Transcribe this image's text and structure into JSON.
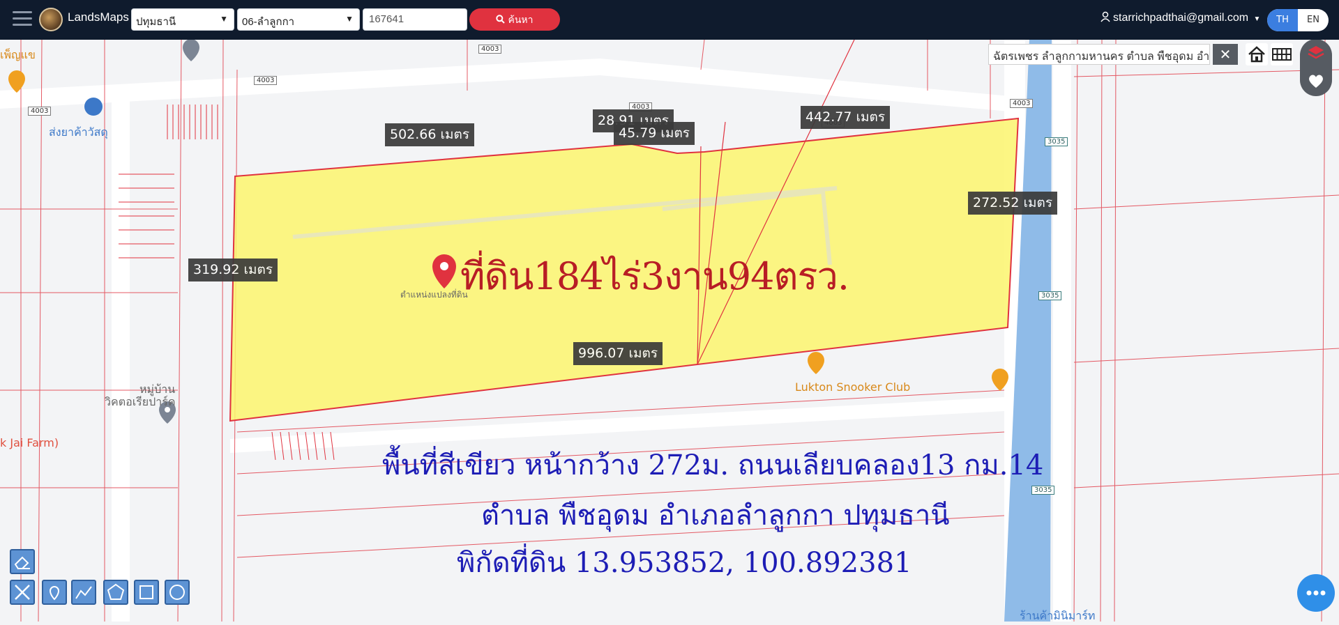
{
  "topbar": {
    "brand": "LandsMaps",
    "province": "ปทุมธานี",
    "district": "06-ลำลูกกา",
    "parcel_no": "167641",
    "search_label": "ค้นหา",
    "user_email": "starrichpadthai@gmail.com",
    "lang_th": "TH",
    "lang_en": "EN"
  },
  "map": {
    "address": "ฉัตรเพชร ลำลูกกามหานคร ตำบล พืชอุดม อำเภ",
    "close_label": "✕",
    "title": "ที่ดิน184ไร่3งาน94ตรว.",
    "pin_label": "ตำแหน่งแปลงที่ดิน",
    "distances": [
      {
        "id": "d1",
        "text": "502.66 เมตร"
      },
      {
        "id": "d2",
        "text": "28.91 เมตร"
      },
      {
        "id": "d3",
        "text": "45.79 เมตร"
      },
      {
        "id": "d4",
        "text": "442.77 เมตร"
      },
      {
        "id": "d5",
        "text": "272.52 เมตร"
      },
      {
        "id": "d6",
        "text": "319.92 เมตร"
      },
      {
        "id": "d7",
        "text": "996.07 เมตร"
      }
    ],
    "roads": {
      "r4003a": "4003",
      "r4003b": "4003",
      "r4003c": "4003",
      "r4003d": "4003",
      "r4003e": "4003",
      "r4003f": "4003",
      "r3035a": "3035",
      "r3035b": "3035",
      "r3035c": "3035"
    },
    "pois": {
      "hardware": "ส่งยาค้าวัสดุ",
      "village_line1": "หมู่บ้าน",
      "village_line2": "วิคตอเรียปาร์ค",
      "farm": "k Jai Farm)",
      "snooker": "Lukton Snooker Club",
      "shop_bottom": "ร้านค้ามินิมาร์ท",
      "top_left": "เพ็ญแข"
    },
    "caption": {
      "line1": "พื้นที่สีเขียว หน้ากว้าง 272ม. ถนนเลียบคลอง13 กม.14",
      "line2": "ตำบล พืชอุดม อำเภอลำลูกกา ปทุมธานี",
      "line3": "พิกัดที่ดิน 13.953852, 100.892381"
    }
  },
  "colors": {
    "topbar": "#0f1b2d",
    "parcel_fill": "#fbf56d",
    "parcel_line": "#e0323f",
    "canal": "#8fbbe8",
    "title": "#b81d25",
    "caption": "#1d1db5",
    "search_button": "#e0323f",
    "lang_active": "#3b7ee0"
  },
  "icons": [
    "menu-icon",
    "search-icon",
    "user-icon",
    "chevron-down-icon",
    "home-icon",
    "grid-icon",
    "layers-icon",
    "heart-icon",
    "more-icon",
    "eraser-icon",
    "ruler-icon",
    "marker-icon",
    "polyline-icon",
    "polygon-icon",
    "rectangle-icon",
    "circle-icon",
    "map-pin-icon"
  ]
}
